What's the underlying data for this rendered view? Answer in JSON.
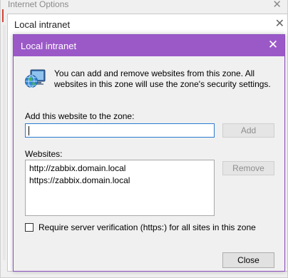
{
  "windows": {
    "internet_options": {
      "title": "Internet Options",
      "close_glyph": "✕"
    },
    "local_intranet_inactive": {
      "title": "Local intranet",
      "close_glyph": "✕"
    }
  },
  "dialog": {
    "title": "Local intranet",
    "close_glyph": "✕",
    "icon": "globe-computer-icon",
    "description": "You can add and remove websites from this zone. All websites in this zone will use the zone's security settings.",
    "add_label": "Add this website to the zone:",
    "add_input_value": "",
    "add_button": "Add",
    "websites_label": "Websites:",
    "websites": [
      "http://zabbix.domain.local",
      "https://zabbix.domain.local"
    ],
    "remove_button": "Remove",
    "require_https_checked": false,
    "require_https_label": "Require server verification (https:) for all sites in this zone",
    "close_button": "Close"
  },
  "colors": {
    "titlebar": "#9b59c8",
    "dialog_bg": "#f0f0f0",
    "input_focus_border": "#2b7bd1"
  }
}
